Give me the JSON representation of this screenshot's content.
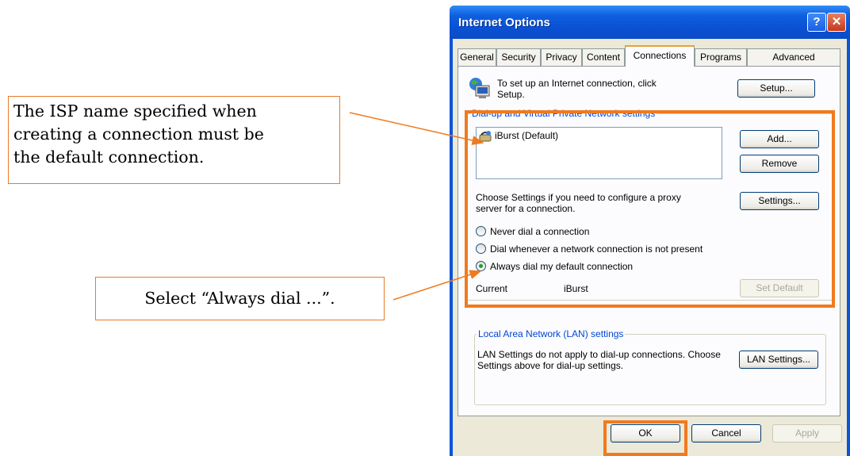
{
  "annotations": {
    "callout1_lines": [
      "The ISP name specified when",
      "creating a connection must be",
      "the default connection."
    ],
    "callout2": "Select “Always dial ...”.",
    "accent_color": "#f07a1e"
  },
  "window": {
    "title": "Internet Options",
    "help_glyph": "?",
    "close_glyph": "✕",
    "tabs": [
      "General",
      "Security",
      "Privacy",
      "Content",
      "Connections",
      "Programs",
      "Advanced"
    ],
    "active_tab": "Connections"
  },
  "connections": {
    "setup_text": "To set up an Internet connection, click Setup.",
    "setup_button": "Setup...",
    "dialup_group_label": "Dial-up and Virtual Private Network settings",
    "connection_items": [
      "iBurst (Default)"
    ],
    "add_button": "Add...",
    "remove_button": "Remove",
    "proxy_text": "Choose Settings if you need to configure a proxy server for a connection.",
    "settings_button": "Settings...",
    "radio_options": [
      "Never dial a connection",
      "Dial whenever a network connection is not present",
      "Always dial my default connection"
    ],
    "selected_radio": "Always dial my default connection",
    "current_label": "Current",
    "current_value": "iBurst",
    "set_default_button": "Set Default",
    "lan_group_label": "Local Area Network (LAN) settings",
    "lan_text": "LAN Settings do not apply to dial-up connections. Choose Settings above for dial-up settings.",
    "lan_settings_button": "LAN Settings..."
  },
  "footer": {
    "ok_button": "OK",
    "cancel_button": "Cancel",
    "apply_button": "Apply"
  }
}
